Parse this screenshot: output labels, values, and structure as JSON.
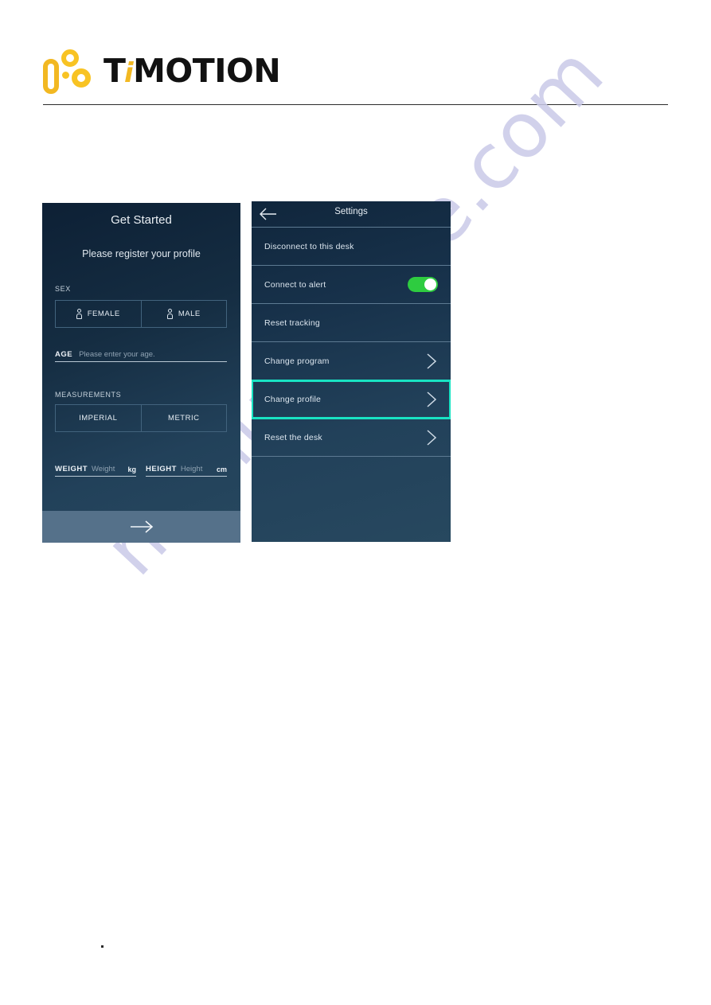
{
  "header": {
    "logo_text_ti": "T",
    "logo_text_i": "i",
    "logo_text_motion": "MOTION",
    "logo_alt": "TiMOTION"
  },
  "watermark": {
    "text": "manualshive.com"
  },
  "get_started_screen": {
    "title": "Get Started",
    "subtitle": "Please register your profile",
    "sex_label": "SEX",
    "sex_options": [
      {
        "label": "FEMALE",
        "icon": "female-person-icon"
      },
      {
        "label": "MALE",
        "icon": "male-person-icon"
      }
    ],
    "age_field": {
      "label": "AGE",
      "placeholder": "Please enter your age.",
      "value": ""
    },
    "measurements_label": "MEASUREMENTS",
    "measurement_options": [
      {
        "label": "IMPERIAL"
      },
      {
        "label": "METRIC"
      }
    ],
    "weight_field": {
      "label": "WEIGHT",
      "placeholder": "Weight",
      "value": "",
      "unit": "kg"
    },
    "height_field": {
      "label": "HEIGHT",
      "placeholder": "Height",
      "value": "",
      "unit": "cm"
    },
    "next_button": {
      "icon": "arrow-right-icon",
      "label": ""
    }
  },
  "settings_screen": {
    "back_icon": "arrow-left-icon",
    "title": "Settings",
    "rows": [
      {
        "label": "Disconnect to this desk",
        "control": "none"
      },
      {
        "label": "Connect to alert",
        "control": "toggle",
        "toggle_on": true
      },
      {
        "label": "Reset tracking",
        "control": "none"
      },
      {
        "label": "Change program",
        "control": "chevron"
      },
      {
        "label": "Change profile",
        "control": "chevron",
        "highlighted": true
      },
      {
        "label": "Reset the desk",
        "control": "chevron"
      }
    ]
  },
  "colors": {
    "brand_yellow": "#f2b822",
    "highlight_cyan": "#19e3c3",
    "toggle_green": "#2ecc40",
    "panel_dark": "#10263c",
    "panel_light": "#27485f",
    "footer_slate": "#55718a",
    "watermark": "#c9c9e8"
  }
}
